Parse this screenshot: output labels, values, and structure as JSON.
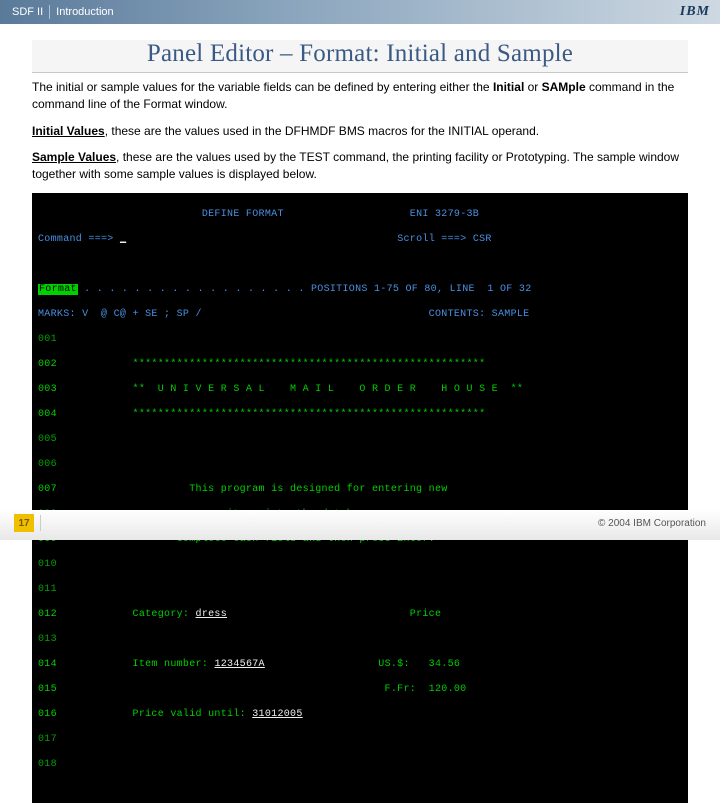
{
  "header": {
    "product": "SDF II",
    "section": "Introduction",
    "logo_text": "IBM"
  },
  "title": "Panel Editor – Format: Initial and Sample",
  "paragraphs": {
    "p1_a": "The initial or sample values for the variable fields can be defined by entering either the ",
    "p1_b_bold": "Initial",
    "p1_c": " or ",
    "p1_d_bold": "SAMple",
    "p1_e": " command in the command line of the Format window.",
    "p2_label": "Initial Values",
    "p2_text": ", these are the values used in the DFHMDF BMS macros for the INITIAL operand.",
    "p3_label": "Sample Values",
    "p3_text": ", these are the values used by the TEST command, the printing facility or Prototyping. The sample window together with some sample values is displayed below."
  },
  "terminal": {
    "top_title": "DEFINE FORMAT",
    "top_right": "ENI 3279-3B",
    "cmd_label": "Command ===>",
    "cmd_value": "_",
    "scroll": "Scroll ===> CSR",
    "fmt_label": "Format",
    "fmt_dots": " . . . . . . . . . . . . . . . . . .",
    "pos_info": "POSITIONS 1-75 OF 80, LINE  1 OF 32",
    "marks": "MARKS: V  @ C@ + SE ; SP /",
    "contents": "CONTENTS: SAMPLE",
    "lines": {
      "l001": "001",
      "l002": "002            ********************************************************",
      "l003": "003            **  U N I V E R S A L    M A I L    O R D E R    H O U S E  **",
      "l004": "004            ********************************************************",
      "l005": "005",
      "l006": "006",
      "l007": "007                     This program is designed for entering new",
      "l008": "008                           items into the database.",
      "l009": "009                   Complete each field and then press Enter.",
      "l010": "010",
      "l011": "011",
      "l012": "012            Category: ",
      "l012_val": "dress",
      "l012_right": "                             Price",
      "l013": "013",
      "l014": "014            Item number: ",
      "l014_val": "1234567A",
      "l014_r1": "                  US.$:   34.56",
      "l015": "015                                                    F.Fr:  120.00",
      "l016": "016            Price valid until: ",
      "l016_val": "31012005",
      "l017": "017",
      "l018": "018"
    }
  },
  "footer": {
    "page": "17",
    "copyright": "© 2004 IBM Corporation"
  }
}
